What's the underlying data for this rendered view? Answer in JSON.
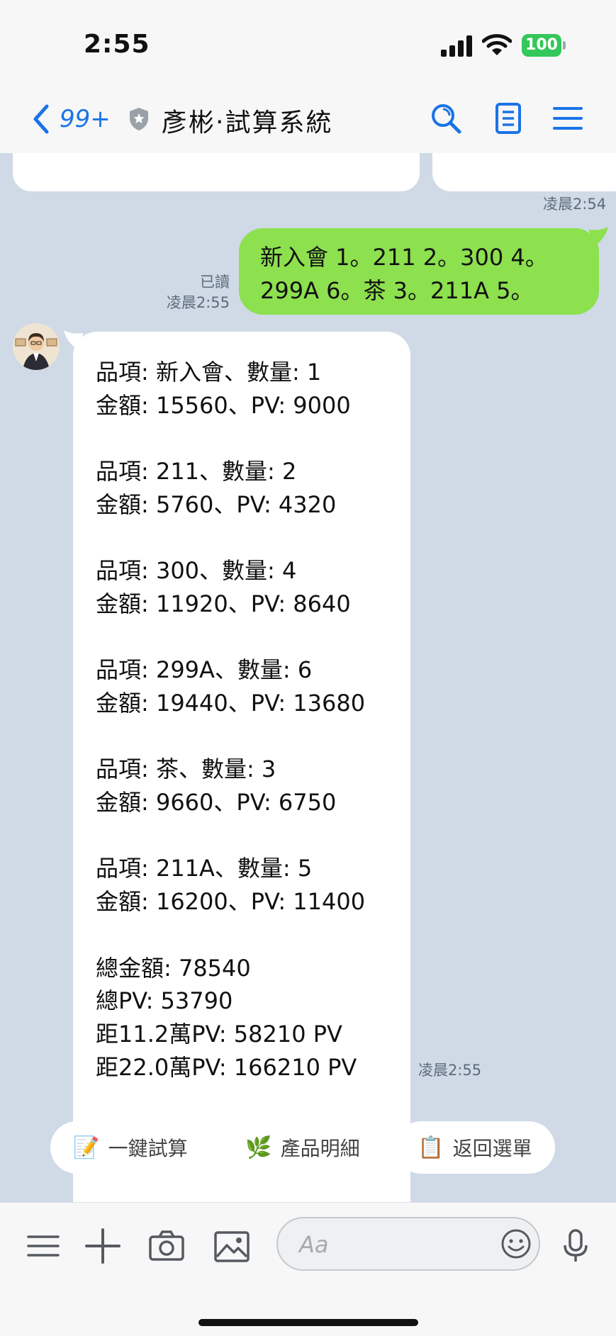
{
  "status_bar": {
    "time": "2:55",
    "battery": "100"
  },
  "header": {
    "back_count": "99+",
    "title": "彥彬‧試算系統"
  },
  "chat": {
    "sent": {
      "timestamp_prev": "凌晨2:54",
      "read_label": "已讀",
      "time": "凌晨2:55",
      "text": "新入會 1。211 2。300 4。299A 6。茶 3。211A 5。"
    },
    "reply": {
      "time": "凌晨2:55",
      "lines": [
        "品項: 新入會、數量: 1",
        "金額: 15560、PV: 9000",
        "",
        "品項: 211、數量: 2",
        "金額: 5760、PV: 4320",
        "",
        "品項: 300、數量: 4",
        "金額: 11920、PV: 8640",
        "",
        "品項: 299A、數量: 6",
        "金額: 19440、PV: 13680",
        "",
        "品項: 茶、數量: 3",
        "金額: 9660、PV: 6750",
        "",
        "品項: 211A、數量: 5",
        "金額: 16200、PV: 11400",
        "",
        "總金額: 78540",
        "總PV: 53790",
        "距11.2萬PV: 58210 PV",
        "距22.0萬PV: 166210 PV"
      ]
    }
  },
  "quick_replies": [
    {
      "icon": "📝",
      "label": "一鍵試算"
    },
    {
      "icon": "🌿",
      "label": "產品明細"
    },
    {
      "icon": "📋",
      "label": "返回選單"
    }
  ],
  "input": {
    "placeholder": "Aa"
  },
  "colors": {
    "chat_bg": "#cfdae6",
    "sent_bubble": "#8de04e",
    "accent": "#1a73e8",
    "battery": "#34c759"
  }
}
